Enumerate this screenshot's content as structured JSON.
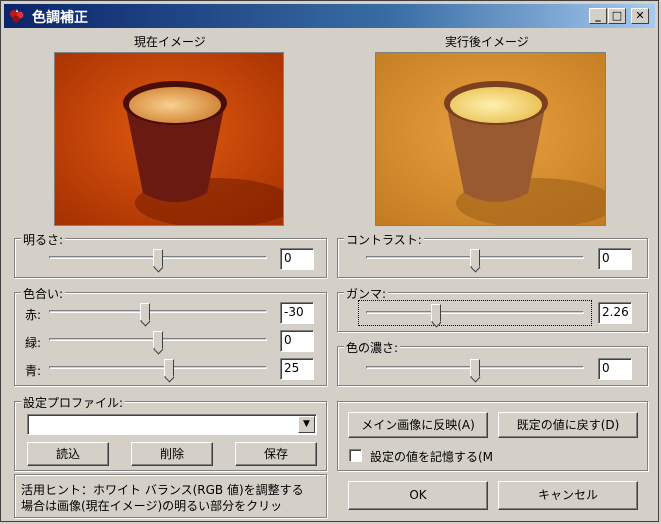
{
  "window": {
    "title": "色調補正",
    "minimize": "_",
    "maximize": "□",
    "close": "✕"
  },
  "labels": {
    "current_image": "現在イメージ",
    "after_image": "実行後イメージ"
  },
  "brightness": {
    "label": "明るさ:",
    "value": "0",
    "level": 0.5
  },
  "contrast": {
    "label": "コントラスト:",
    "value": "0",
    "level": 0.5
  },
  "hue": {
    "label": "色合い:",
    "red": {
      "label": "赤:",
      "value": "-30",
      "level": 0.44
    },
    "green": {
      "label": "緑:",
      "value": "0",
      "level": 0.5
    },
    "blue": {
      "label": "青:",
      "value": "25",
      "level": 0.55
    }
  },
  "gamma": {
    "label": "ガンマ:",
    "value": "2.26",
    "level": 0.32
  },
  "saturation": {
    "label": "色の濃さ:",
    "value": "0",
    "level": 0.5
  },
  "profile": {
    "label": "設定プロファイル:",
    "selected": "",
    "load": "読込",
    "delete": "削除",
    "save": "保存"
  },
  "actions": {
    "apply_main": "メイン画像に反映(A)",
    "reset_default": "既定の値に戻す(D)",
    "remember_label": "設定の値を記憶する(M",
    "remember_checked": false
  },
  "hint": {
    "line1": "活用ヒント：ホワイト バランス(RGB 値)を調整する",
    "line2": "場合は画像(現在イメージ)の明るい部分をクリッ"
  },
  "buttons": {
    "ok": "OK",
    "cancel": "キャンセル"
  }
}
